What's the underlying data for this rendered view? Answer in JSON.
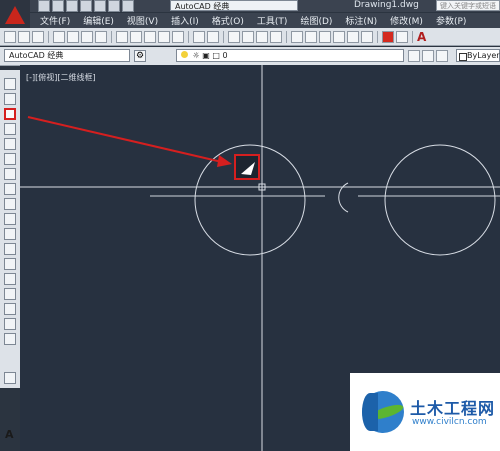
{
  "window": {
    "workspace_quick": "AutoCAD 经典",
    "document_title": "Drawing1.dwg",
    "search_placeholder": "键入关键字或短语"
  },
  "menubar": {
    "items": [
      "文件(F)",
      "编辑(E)",
      "视图(V)",
      "插入(I)",
      "格式(O)",
      "工具(T)",
      "绘图(D)",
      "标注(N)",
      "修改(M)",
      "参数(P)"
    ]
  },
  "toolbar2": {
    "workspace_value": "AutoCAD 经典",
    "layer_value": "0",
    "linetype_value": "ByLayer"
  },
  "canvas": {
    "viewport_label": "[-][俯视][二维线框]",
    "background": "#273140",
    "crosshair_color": "#d8dde5",
    "arrow_color": "#d51f1f"
  },
  "watermark": {
    "brand": "土木工程网",
    "url": "www.civilcn.com"
  },
  "icons": {
    "app_logo": "autocad-logo-icon",
    "active_tool": "revcloud-icon",
    "cursor": "pick-cursor-icon"
  }
}
